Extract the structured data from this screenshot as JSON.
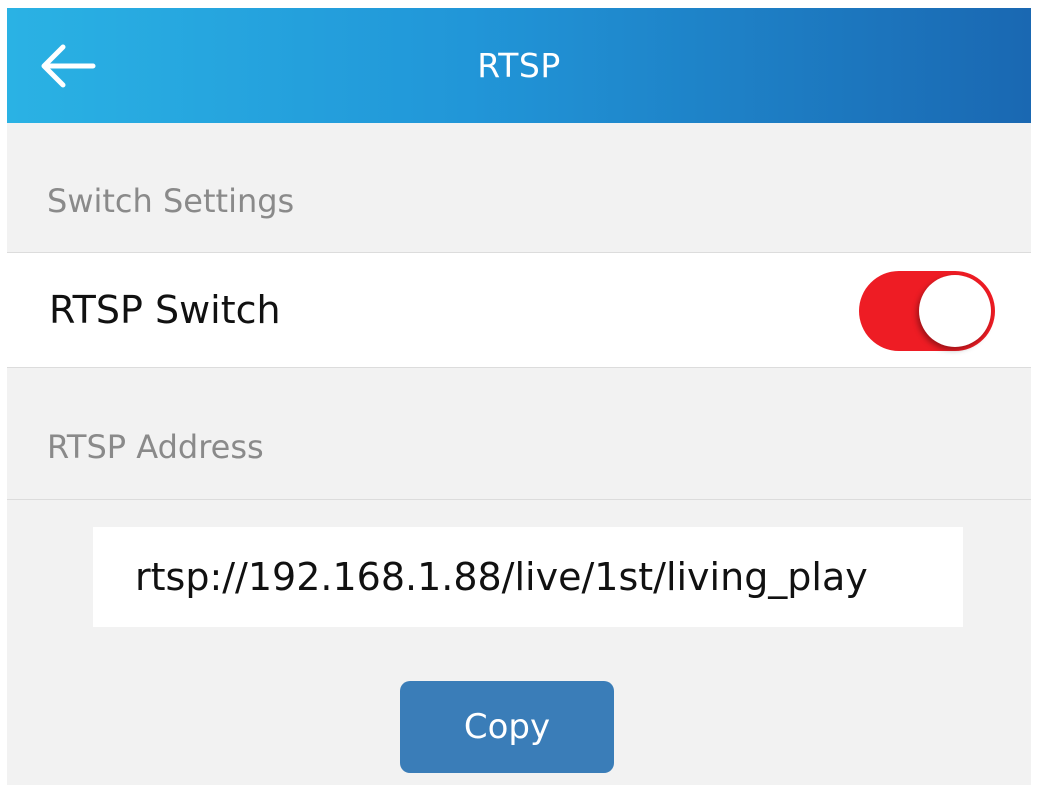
{
  "app_bar": {
    "title": "RTSP",
    "back_icon": "back-arrow-icon"
  },
  "sections": {
    "switch_settings": "Switch Settings",
    "rtsp_address": "RTSP Address"
  },
  "rtsp_switch": {
    "label": "RTSP Switch",
    "enabled": true,
    "on_color": "#ee1c24"
  },
  "address": {
    "value": "rtsp://192.168.1.88/live/1st/living_play"
  },
  "copy_button": {
    "label": "Copy",
    "color": "#3a7db8"
  }
}
